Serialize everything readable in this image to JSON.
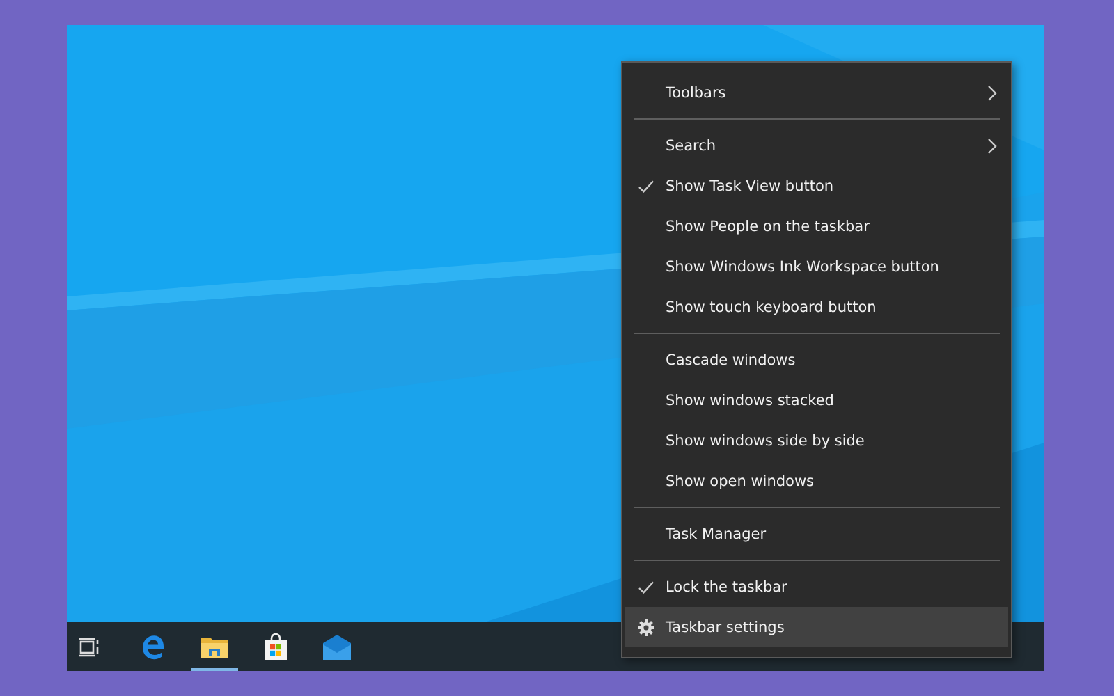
{
  "taskbar": {
    "apps": [
      {
        "kind": "task-view",
        "running": false
      },
      {
        "kind": "browser",
        "running": false
      },
      {
        "kind": "folder",
        "running": true
      },
      {
        "kind": "store",
        "running": false
      },
      {
        "kind": "mail",
        "running": false
      }
    ]
  },
  "context_menu": {
    "groups": [
      {
        "items": [
          {
            "label": "Toolbars",
            "kind": "submenu",
            "checked": false,
            "selected": false
          }
        ]
      },
      {
        "items": [
          {
            "label": "Search",
            "kind": "submenu",
            "checked": false,
            "selected": false
          },
          {
            "label": "Show Task View button",
            "kind": "command",
            "checked": true,
            "selected": false
          },
          {
            "label": "Show People on the taskbar",
            "kind": "command",
            "checked": false,
            "selected": false
          },
          {
            "label": "Show Windows Ink Workspace button",
            "kind": "command",
            "checked": false,
            "selected": false
          },
          {
            "label": "Show touch keyboard button",
            "kind": "command",
            "checked": false,
            "selected": false
          }
        ]
      },
      {
        "items": [
          {
            "label": "Cascade windows",
            "kind": "command",
            "checked": false,
            "selected": false
          },
          {
            "label": "Show windows stacked",
            "kind": "command",
            "checked": false,
            "selected": false
          },
          {
            "label": "Show windows side by side",
            "kind": "command",
            "checked": false,
            "selected": false
          },
          {
            "label": "Show open windows",
            "kind": "command",
            "checked": false,
            "selected": false
          }
        ]
      },
      {
        "items": [
          {
            "label": "Task Manager",
            "kind": "command",
            "checked": false,
            "selected": false
          }
        ]
      },
      {
        "items": [
          {
            "label": "Lock the taskbar",
            "kind": "command",
            "checked": true,
            "selected": false
          },
          {
            "label": "Taskbar settings",
            "kind": "settings",
            "checked": false,
            "selected": true
          }
        ]
      }
    ]
  }
}
